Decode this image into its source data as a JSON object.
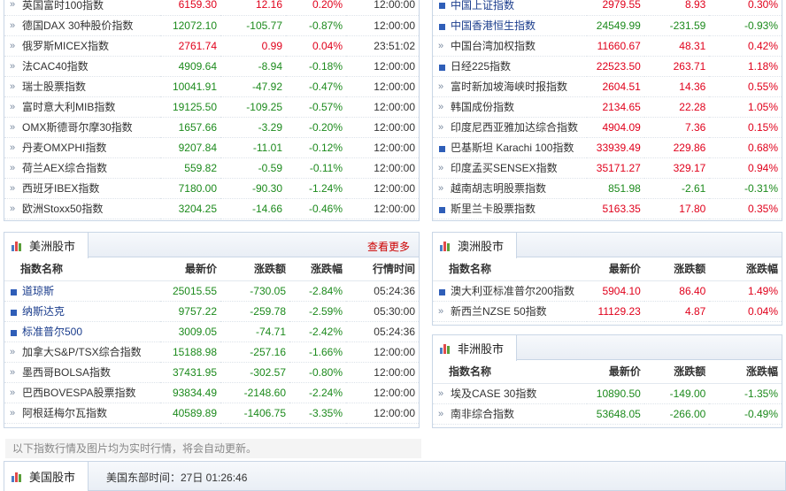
{
  "europe": {
    "rows": [
      {
        "name": "英国富时100指数",
        "price": "6159.30",
        "chg": "12.16",
        "pct": "0.20%",
        "time": "12:00:00",
        "dir": "up"
      },
      {
        "name": "德国DAX 30种股价指数",
        "price": "12072.10",
        "chg": "-105.77",
        "pct": "-0.87%",
        "time": "12:00:00",
        "dir": "dn"
      },
      {
        "name": "俄罗斯MICEX指数",
        "price": "2761.74",
        "chg": "0.99",
        "pct": "0.04%",
        "time": "23:51:02",
        "dir": "up"
      },
      {
        "name": "法CAC40指数",
        "price": "4909.64",
        "chg": "-8.94",
        "pct": "-0.18%",
        "time": "12:00:00",
        "dir": "dn"
      },
      {
        "name": "瑞士股票指数",
        "price": "10041.91",
        "chg": "-47.92",
        "pct": "-0.47%",
        "time": "12:00:00",
        "dir": "dn"
      },
      {
        "name": "富时意大利MIB指数",
        "price": "19125.50",
        "chg": "-109.25",
        "pct": "-0.57%",
        "time": "12:00:00",
        "dir": "dn"
      },
      {
        "name": "OMX斯德哥尔摩30指数",
        "price": "1657.66",
        "chg": "-3.29",
        "pct": "-0.20%",
        "time": "12:00:00",
        "dir": "dn"
      },
      {
        "name": "丹麦OMXPHI指数",
        "price": "9207.84",
        "chg": "-11.01",
        "pct": "-0.12%",
        "time": "12:00:00",
        "dir": "dn"
      },
      {
        "name": "荷兰AEX综合指数",
        "price": "559.82",
        "chg": "-0.59",
        "pct": "-0.11%",
        "time": "12:00:00",
        "dir": "dn"
      },
      {
        "name": "西班牙IBEX指数",
        "price": "7180.00",
        "chg": "-90.30",
        "pct": "-1.24%",
        "time": "12:00:00",
        "dir": "dn"
      },
      {
        "name": "欧洲Stoxx50指数",
        "price": "3204.25",
        "chg": "-14.66",
        "pct": "-0.46%",
        "time": "12:00:00",
        "dir": "dn"
      }
    ]
  },
  "asia": {
    "rows": [
      {
        "name": "中国上证指数",
        "price": "2979.55",
        "chg": "8.93",
        "pct": "0.30%",
        "dir": "up",
        "marker": "sq",
        "link": true
      },
      {
        "name": "中国香港恒生指数",
        "price": "24549.99",
        "chg": "-231.59",
        "pct": "-0.93%",
        "dir": "dn",
        "marker": "sq",
        "link": true
      },
      {
        "name": "中国台湾加权指数",
        "price": "11660.67",
        "chg": "48.31",
        "pct": "0.42%",
        "dir": "up",
        "marker": "arrow",
        "link": false
      },
      {
        "name": "日经225指数",
        "price": "22523.50",
        "chg": "263.71",
        "pct": "1.18%",
        "dir": "up",
        "marker": "sq",
        "link": false
      },
      {
        "name": "富时新加坡海峡时报指数",
        "price": "2604.51",
        "chg": "14.36",
        "pct": "0.55%",
        "dir": "up",
        "marker": "arrow",
        "link": false
      },
      {
        "name": "韩国成份指数",
        "price": "2134.65",
        "chg": "22.28",
        "pct": "1.05%",
        "dir": "up",
        "marker": "arrow",
        "link": false
      },
      {
        "name": "印度尼西亚雅加达综合指数",
        "price": "4904.09",
        "chg": "7.36",
        "pct": "0.15%",
        "dir": "up",
        "marker": "arrow",
        "link": false
      },
      {
        "name": "巴基斯坦 Karachi 100指数",
        "price": "33939.49",
        "chg": "229.86",
        "pct": "0.68%",
        "dir": "up",
        "marker": "sq",
        "link": false
      },
      {
        "name": "印度孟买SENSEX指数",
        "price": "35171.27",
        "chg": "329.17",
        "pct": "0.94%",
        "dir": "up",
        "marker": "arrow",
        "link": false
      },
      {
        "name": "越南胡志明股票指数",
        "price": "851.98",
        "chg": "-2.61",
        "pct": "-0.31%",
        "dir": "dn",
        "marker": "arrow",
        "link": false
      },
      {
        "name": "斯里兰卡股票指数",
        "price": "5163.35",
        "chg": "17.80",
        "pct": "0.35%",
        "dir": "up",
        "marker": "sq",
        "link": false
      }
    ]
  },
  "america": {
    "title": "美洲股市",
    "more": "查看更多",
    "headers": [
      "指数名称",
      "最新价",
      "涨跌额",
      "涨跌幅",
      "行情时间"
    ],
    "rows": [
      {
        "name": "道琼斯",
        "price": "25015.55",
        "chg": "-730.05",
        "pct": "-2.84%",
        "time": "05:24:36",
        "dir": "dn",
        "marker": "sq",
        "link": true
      },
      {
        "name": "纳斯达克",
        "price": "9757.22",
        "chg": "-259.78",
        "pct": "-2.59%",
        "time": "05:30:00",
        "dir": "dn",
        "marker": "sq",
        "link": true
      },
      {
        "name": "标准普尔500",
        "price": "3009.05",
        "chg": "-74.71",
        "pct": "-2.42%",
        "time": "05:24:36",
        "dir": "dn",
        "marker": "sq",
        "link": true
      },
      {
        "name": "加拿大S&P/TSX综合指数",
        "price": "15188.98",
        "chg": "-257.16",
        "pct": "-1.66%",
        "time": "12:00:00",
        "dir": "dn",
        "marker": "arrow",
        "link": false
      },
      {
        "name": "墨西哥BOLSA指数",
        "price": "37431.95",
        "chg": "-302.57",
        "pct": "-0.80%",
        "time": "12:00:00",
        "dir": "dn",
        "marker": "arrow",
        "link": false
      },
      {
        "name": "巴西BOVESPA股票指数",
        "price": "93834.49",
        "chg": "-2148.60",
        "pct": "-2.24%",
        "time": "12:00:00",
        "dir": "dn",
        "marker": "arrow",
        "link": false
      },
      {
        "name": "阿根廷梅尔瓦指数",
        "price": "40589.89",
        "chg": "-1406.75",
        "pct": "-3.35%",
        "time": "12:00:00",
        "dir": "dn",
        "marker": "arrow",
        "link": false
      }
    ]
  },
  "australia": {
    "title": "澳洲股市",
    "headers": [
      "指数名称",
      "最新价",
      "涨跌额",
      "涨跌幅"
    ],
    "rows": [
      {
        "name": "澳大利亚标准普尔200指数",
        "price": "5904.10",
        "chg": "86.40",
        "pct": "1.49%",
        "dir": "up",
        "marker": "sq"
      },
      {
        "name": "新西兰NZSE 50指数",
        "price": "11129.23",
        "chg": "4.87",
        "pct": "0.04%",
        "dir": "up",
        "marker": "arrow"
      }
    ]
  },
  "africa": {
    "title": "非洲股市",
    "headers": [
      "指数名称",
      "最新价",
      "涨跌额",
      "涨跌幅"
    ],
    "rows": [
      {
        "name": "埃及CASE 30指数",
        "price": "10890.50",
        "chg": "-149.00",
        "pct": "-1.35%",
        "dir": "dn",
        "marker": "arrow"
      },
      {
        "name": "南非综合指数",
        "price": "53648.05",
        "chg": "-266.00",
        "pct": "-0.49%",
        "dir": "dn",
        "marker": "arrow"
      }
    ]
  },
  "notice": "以下指数行情及图片均为实时行情，将会自动更新。",
  "us": {
    "title": "美国股市",
    "time_label": "美国东部时间：27日 01:26:46"
  },
  "colors": {
    "up": "#e0001b",
    "down": "#1c8a1c",
    "link": "#1a3c8c",
    "border": "#c9d6e6"
  }
}
